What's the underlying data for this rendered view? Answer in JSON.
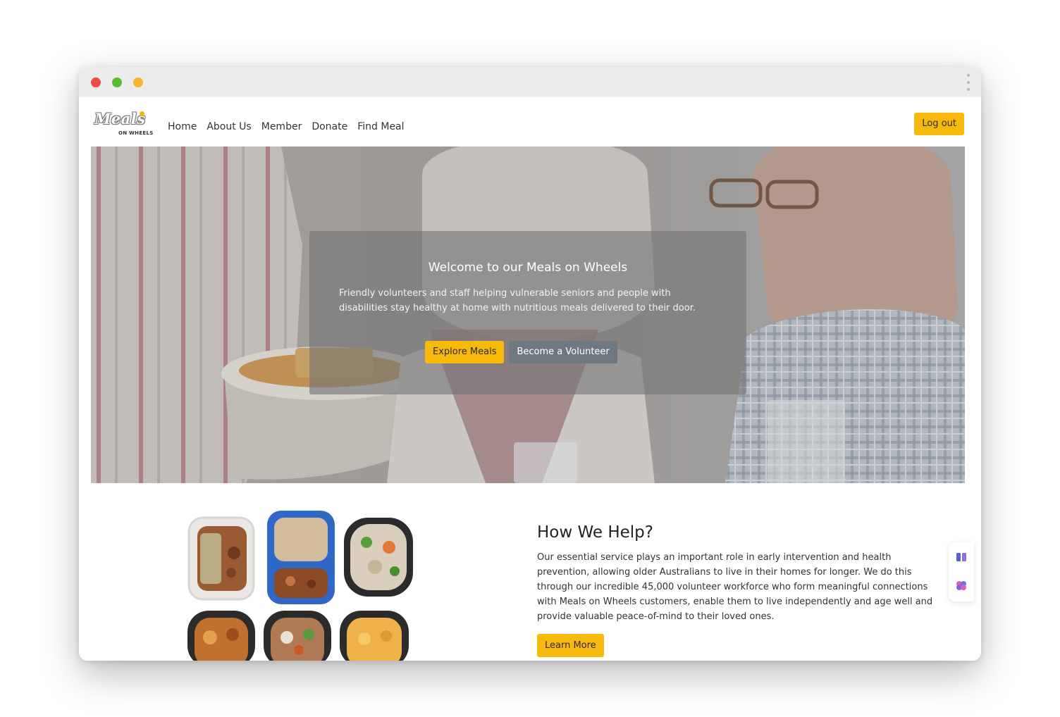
{
  "browser": {
    "controls": [
      "close",
      "minimize",
      "maximize"
    ],
    "menu_icon": "kebab-menu-icon"
  },
  "brand": {
    "logo_main": "Meals",
    "logo_sub": "ON WHEELS",
    "accent_color": "#f6b90c"
  },
  "nav": {
    "links": [
      {
        "label": "Home"
      },
      {
        "label": "About Us"
      },
      {
        "label": "Member"
      },
      {
        "label": "Donate"
      },
      {
        "label": "Find Meal"
      }
    ],
    "logout_label": "Log out"
  },
  "hero": {
    "title": "Welcome to our Meals on Wheels",
    "text": "Friendly volunteers and staff helping vulnerable seniors and people with disabilities stay healthy at home with nutritious meals delivered to their door.",
    "primary_button": "Explore Meals",
    "secondary_button": "Become a Volunteer"
  },
  "help": {
    "title": "How We Help?",
    "text": "Our essential service plays an important role in early intervention and health prevention, allowing older Australians to live in their homes for longer. We do this through our incredible 45,000 volunteer workforce who form meaningful connections with Meals on Wheels customers, enable them to live independently and age well and provide valuable peace-of-mind to their loved ones.",
    "button": "Learn More"
  },
  "side_widget": {
    "icons": [
      "book-icon",
      "brain-icon"
    ]
  }
}
